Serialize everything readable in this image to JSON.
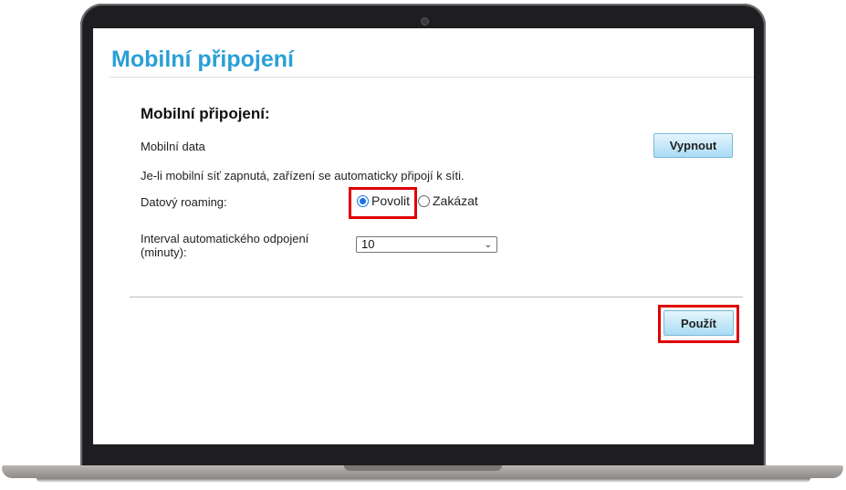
{
  "header": {
    "title": "Mobilní připojení"
  },
  "section": {
    "title": "Mobilní připojení:"
  },
  "mobile_data": {
    "label": "Mobilní data",
    "button_label": "Vypnout"
  },
  "info_text": "Je-li mobilní síť zapnutá, zařízení se automaticky připojí k síti.",
  "roaming": {
    "label": "Datový roaming:",
    "options": [
      "Povolit",
      "Zakázat"
    ],
    "selected": "Povolit"
  },
  "interval": {
    "label_line1": "Interval automatického odpojení",
    "label_line2": "(minuty):",
    "selected_value": "10"
  },
  "actions": {
    "apply_label": "Použít"
  },
  "colors": {
    "title": "#2a9fd6",
    "highlight": "#e00000",
    "radio_accent": "#1a73e8"
  }
}
